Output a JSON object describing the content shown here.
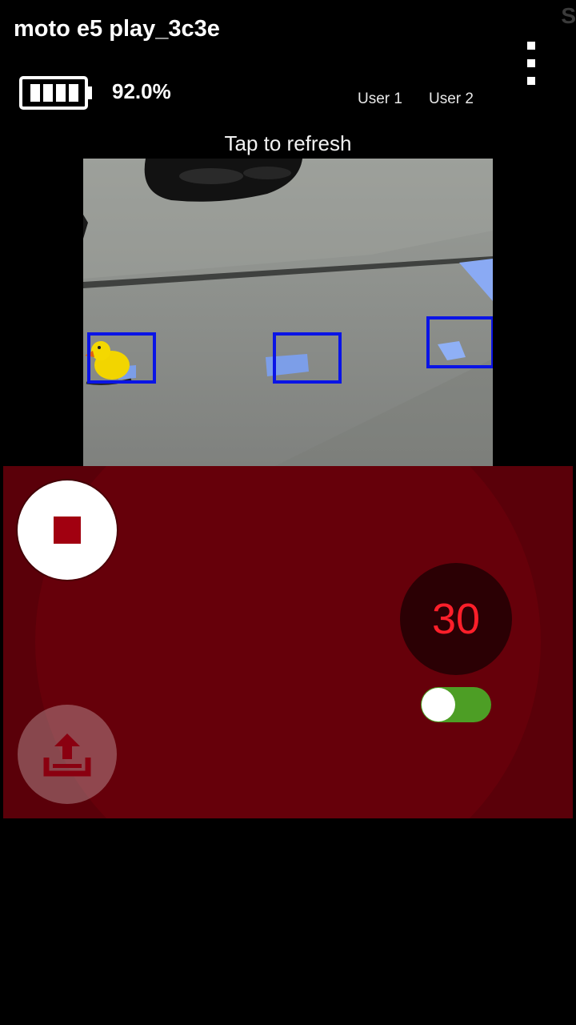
{
  "header": {
    "device_name": "moto e5 play_3c3e",
    "corner_glyph": "S",
    "battery": {
      "icon": "battery-full-icon",
      "percent_label": "92.0%",
      "level": 0.92
    },
    "menu_icon": "overflow-menu-icon",
    "user_tabs": [
      "User 1",
      "User 2"
    ]
  },
  "camera": {
    "refresh_label": "Tap to refresh",
    "detections": 3,
    "box_color": "#0a14e6"
  },
  "controls": {
    "panel_color": "#5a0009",
    "record_button_icon": "stop-icon",
    "counter_value": "30",
    "counter_color": "#ff1f2a",
    "toggle_on": true,
    "toggle_color": "#4d9e25",
    "upload_button_icon": "upload-icon"
  }
}
